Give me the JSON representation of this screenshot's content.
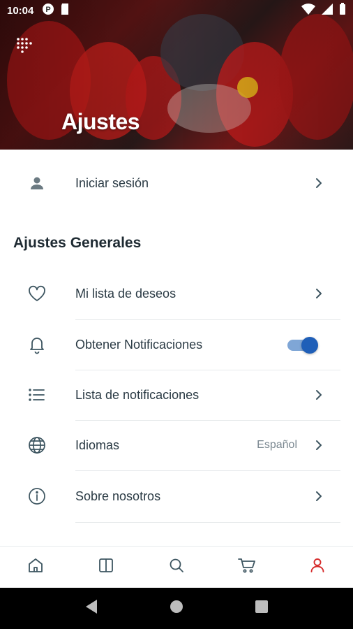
{
  "status_bar": {
    "time": "10:04"
  },
  "header": {
    "title": "Ajustes",
    "background_image": "pit-stop-crew-photo"
  },
  "account": {
    "label": "Iniciar sesión",
    "icon": "person-icon"
  },
  "general": {
    "section_title": "Ajustes Generales",
    "items": [
      {
        "label": "Mi lista de deseos",
        "icon": "heart-icon"
      },
      {
        "label": "Obtener Notificaciones",
        "icon": "bell-icon",
        "toggle_on": true
      },
      {
        "label": "Lista de notificaciones",
        "icon": "list-icon"
      },
      {
        "label": "Idiomas",
        "icon": "globe-icon",
        "value": "Español"
      },
      {
        "label": "Sobre nosotros",
        "icon": "info-icon"
      }
    ]
  },
  "bottom_nav": {
    "items": [
      {
        "icon": "home-icon",
        "active": false
      },
      {
        "icon": "book-icon",
        "active": false
      },
      {
        "icon": "search-icon",
        "active": false
      },
      {
        "icon": "cart-icon",
        "active": false
      },
      {
        "icon": "profile-icon",
        "active": true
      }
    ]
  },
  "colors": {
    "accent": "#1f5fb8",
    "active_nav": "#d62b2b",
    "icon": "#3d5560",
    "text": "#2a3a44"
  }
}
